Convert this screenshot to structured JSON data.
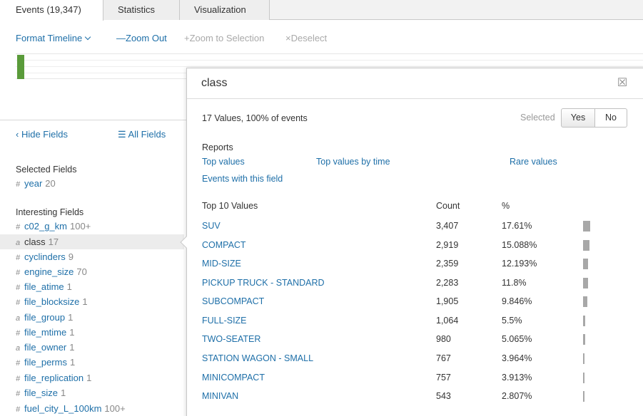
{
  "tabs": [
    {
      "label": "Events (19,347)",
      "active": true
    },
    {
      "label": "Statistics",
      "active": false
    },
    {
      "label": "Visualization",
      "active": false
    }
  ],
  "timeline": {
    "format_label": "Format Timeline",
    "zoom_out_label": "—Zoom Out",
    "zoom_selection_label": "+Zoom to Selection",
    "deselect_label": "×Deselect"
  },
  "sidebar": {
    "hide_fields_label": "‹ Hide Fields",
    "all_fields_label": "☰ All Fields",
    "selected_heading": "Selected Fields",
    "selected_fields": [
      {
        "type": "#",
        "name": "year",
        "count": "20"
      }
    ],
    "interesting_heading": "Interesting Fields",
    "interesting_fields": [
      {
        "type": "#",
        "name": "c02_g_km",
        "count": "100+"
      },
      {
        "type": "a",
        "name": "class",
        "count": "17"
      },
      {
        "type": "#",
        "name": "cyclinders",
        "count": "9"
      },
      {
        "type": "#",
        "name": "engine_size",
        "count": "70"
      },
      {
        "type": "#",
        "name": "file_atime",
        "count": "1"
      },
      {
        "type": "#",
        "name": "file_blocksize",
        "count": "1"
      },
      {
        "type": "a",
        "name": "file_group",
        "count": "1"
      },
      {
        "type": "#",
        "name": "file_mtime",
        "count": "1"
      },
      {
        "type": "a",
        "name": "file_owner",
        "count": "1"
      },
      {
        "type": "#",
        "name": "file_perms",
        "count": "1"
      },
      {
        "type": "#",
        "name": "file_replication",
        "count": "1"
      },
      {
        "type": "#",
        "name": "file_size",
        "count": "1"
      },
      {
        "type": "#",
        "name": "fuel_city_L_100km",
        "count": "100+"
      }
    ]
  },
  "popup": {
    "title": "class",
    "close_glyph": "☒",
    "values_info": "17 Values, 100% of events",
    "selected_label": "Selected",
    "yes_label": "Yes",
    "no_label": "No",
    "reports_heading": "Reports",
    "report_links": {
      "top_values": "Top values",
      "top_values_by_time": "Top values by time",
      "rare_values": "Rare values",
      "events_with_field": "Events with this field"
    },
    "table_headers": {
      "value": "Top 10 Values",
      "count": "Count",
      "percent": "%"
    },
    "rows": [
      {
        "value": "SUV",
        "count": "3,407",
        "percent": "17.61%",
        "pct": 17.61
      },
      {
        "value": "COMPACT",
        "count": "2,919",
        "percent": "15.088%",
        "pct": 15.088
      },
      {
        "value": "MID-SIZE",
        "count": "2,359",
        "percent": "12.193%",
        "pct": 12.193
      },
      {
        "value": "PICKUP TRUCK - STANDARD",
        "count": "2,283",
        "percent": "11.8%",
        "pct": 11.8
      },
      {
        "value": "SUBCOMPACT",
        "count": "1,905",
        "percent": "9.846%",
        "pct": 9.846
      },
      {
        "value": "FULL-SIZE",
        "count": "1,064",
        "percent": "5.5%",
        "pct": 5.5
      },
      {
        "value": "TWO-SEATER",
        "count": "980",
        "percent": "5.065%",
        "pct": 5.065
      },
      {
        "value": "STATION WAGON - SMALL",
        "count": "767",
        "percent": "3.964%",
        "pct": 3.964
      },
      {
        "value": "MINICOMPACT",
        "count": "757",
        "percent": "3.913%",
        "pct": 3.913
      },
      {
        "value": "MINIVAN",
        "count": "543",
        "percent": "2.807%",
        "pct": 2.807
      }
    ]
  },
  "colors": {
    "link": "#1e6fa8",
    "timeline_bar": "#5a9b3a",
    "percent_bar": "#a8a8a8",
    "selected_row": "#ececec"
  },
  "icons": {
    "chevron": "chevron-down-icon",
    "list": "list-icon",
    "close": "close-icon"
  }
}
